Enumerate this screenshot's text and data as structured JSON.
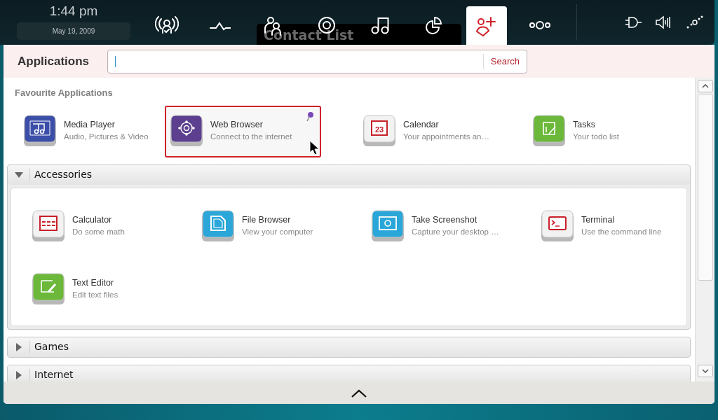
{
  "clock": {
    "time": "1:44 pm",
    "date": "May 19, 2009"
  },
  "toolbar": {
    "items": [
      {
        "selected": false
      },
      {
        "selected": false
      },
      {
        "selected": false
      },
      {
        "selected": false
      },
      {
        "selected": false
      },
      {
        "selected": false
      },
      {
        "selected": true
      },
      {
        "selected": false
      }
    ]
  },
  "tooltip": "Contact List",
  "header": {
    "title": "Applications",
    "search": {
      "button": "Search"
    }
  },
  "favourites": {
    "title": "Favourite Applications",
    "apps": [
      {
        "name": "Media Player",
        "description": "Audio, Pictures & Video",
        "selected": false,
        "pinned": false
      },
      {
        "name": "Web Browser",
        "description": "Connect to the internet",
        "selected": true,
        "pinned": true
      },
      {
        "name": "Calendar",
        "description": "Your appointments an…",
        "selected": false,
        "pinned": false,
        "icon_text": "23"
      },
      {
        "name": "Tasks",
        "description": "Your todo list",
        "selected": false,
        "pinned": false
      }
    ]
  },
  "categories": [
    {
      "name": "Accessories",
      "expanded": true,
      "apps": [
        {
          "name": "Calculator",
          "description": "Do some math"
        },
        {
          "name": "File Browser",
          "description": "View your computer"
        },
        {
          "name": "Take Screenshot",
          "description": "Capture your desktop …"
        },
        {
          "name": "Terminal",
          "description": "Use the command line"
        },
        {
          "name": "Text Editor",
          "description": "Edit text files"
        }
      ]
    },
    {
      "name": "Games",
      "expanded": false
    },
    {
      "name": "Internet",
      "expanded": false
    }
  ]
}
